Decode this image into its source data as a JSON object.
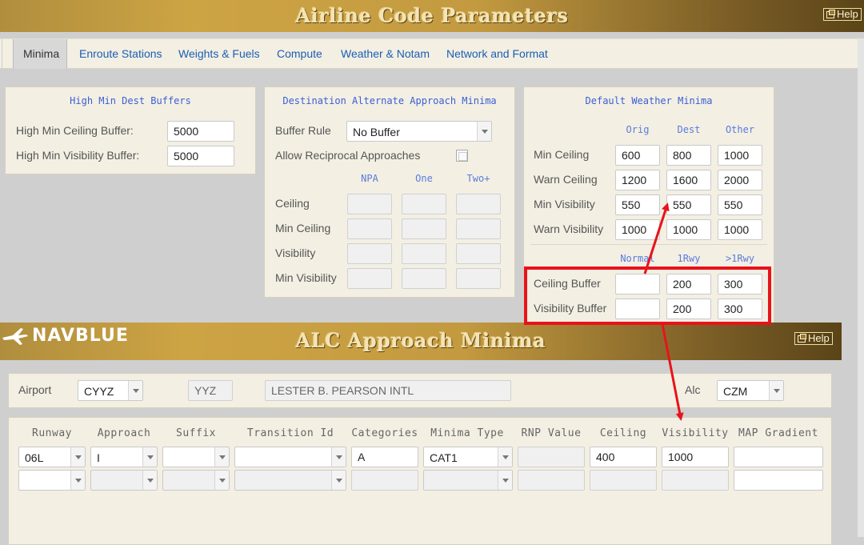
{
  "top_bar": {
    "title": "Airline Code Parameters",
    "help": "Help"
  },
  "tabs": [
    {
      "label": "Minima",
      "active": true
    },
    {
      "label": "Enroute Stations",
      "active": false
    },
    {
      "label": "Weights & Fuels",
      "active": false
    },
    {
      "label": "Compute",
      "active": false
    },
    {
      "label": "Weather & Notam",
      "active": false
    },
    {
      "label": "Network and Format",
      "active": false
    }
  ],
  "high_min": {
    "title": "High Min Dest Buffers",
    "ceiling_label": "High Min Ceiling Buffer:",
    "ceiling_value": "5000",
    "visibility_label": "High Min Visibility Buffer:",
    "visibility_value": "5000"
  },
  "dest_alt": {
    "title": "Destination Alternate Approach Minima",
    "buffer_rule_label": "Buffer Rule",
    "buffer_rule_value": "No Buffer",
    "reciprocal_label": "Allow Reciprocal Approaches",
    "col_headers": [
      "NPA",
      "One",
      "Two+"
    ],
    "rows": [
      "Ceiling",
      "Min Ceiling",
      "Visibility",
      "Min Visibility"
    ]
  },
  "default_wx": {
    "title": "Default Weather Minima",
    "col_headers": [
      "Orig",
      "Dest",
      "Other"
    ],
    "rows": [
      {
        "label": "Min Ceiling",
        "values": [
          "600",
          "800",
          "1000"
        ]
      },
      {
        "label": "Warn Ceiling",
        "values": [
          "1200",
          "1600",
          "2000"
        ]
      },
      {
        "label": "Min Visibility",
        "values": [
          "550",
          "550",
          "550"
        ]
      },
      {
        "label": "Warn Visibility",
        "values": [
          "1000",
          "1000",
          "1000"
        ]
      }
    ],
    "buffer_headers": [
      "Normal",
      "1Rwy",
      ">1Rwy"
    ],
    "buffer_rows": [
      {
        "label": "Ceiling Buffer",
        "values": [
          "",
          "200",
          "300"
        ]
      },
      {
        "label": "Visibility Buffer",
        "values": [
          "",
          "200",
          "300"
        ]
      }
    ]
  },
  "bottom_bar": {
    "logo": "NAVBLUE",
    "title": "ALC Approach Minima",
    "help": "Help"
  },
  "airport_row": {
    "airport_label": "Airport",
    "airport_value": "CYYZ",
    "iata_value": "YYZ",
    "name_value": "LESTER B. PEARSON INTL",
    "alc_label": "Alc",
    "alc_value": "CZM"
  },
  "grid": {
    "headers": [
      "Runway",
      "Approach",
      "Suffix",
      "Transition Id",
      "Categories",
      "Minima Type",
      "RNP Value",
      "Ceiling",
      "Visibility",
      "MAP Gradient"
    ],
    "rows": [
      {
        "runway": "06L",
        "approach": "I",
        "suffix": "",
        "transition": "",
        "categories": "A",
        "minima_type": "CAT1",
        "rnp": "",
        "ceiling": "400",
        "visibility": "1000",
        "map_gradient": ""
      },
      {
        "runway": "",
        "approach": "",
        "suffix": "",
        "transition": "",
        "categories": "",
        "minima_type": "",
        "rnp": "",
        "ceiling": "",
        "visibility": "",
        "map_gradient": ""
      }
    ]
  },
  "colors": {
    "accent_red": "#e8131b",
    "link_blue": "#1a5fb4",
    "gold": "#c39a40"
  }
}
